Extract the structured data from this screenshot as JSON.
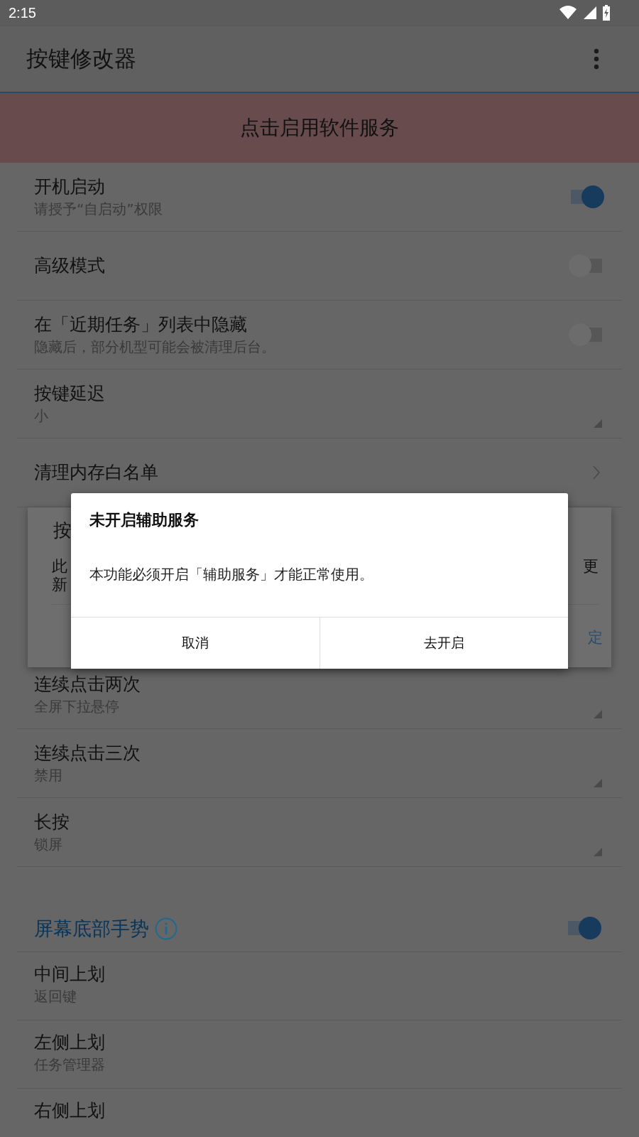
{
  "status_bar": {
    "time": "2:15"
  },
  "app_bar": {
    "title": "按键修改器"
  },
  "banner": {
    "text": "点击启用软件服务"
  },
  "settings": [
    {
      "kind": "switch",
      "title": "开机启动",
      "subtitle": "请授予“自启动”权限",
      "on": true
    },
    {
      "kind": "switch",
      "title": "高级模式",
      "on": false
    },
    {
      "kind": "switch",
      "title": "在「近期任务」列表中隐藏",
      "subtitle": "隐藏后，部分机型可能会被清理后台。",
      "on": false
    },
    {
      "kind": "dropdown",
      "title": "按键延迟",
      "subtitle": "小"
    },
    {
      "kind": "link",
      "title": "清理内存白名单"
    }
  ],
  "click_settings": [
    {
      "kind": "dropdown",
      "title": "连续点击两次",
      "subtitle": "全屏下拉悬停"
    },
    {
      "kind": "dropdown",
      "title": "连续点击三次",
      "subtitle": "禁用"
    },
    {
      "kind": "dropdown",
      "title": "长按",
      "subtitle": "锁屏"
    }
  ],
  "gesture_section": {
    "title": "屏幕底部手势",
    "on": true,
    "items": [
      {
        "kind": "text",
        "title": "中间上划",
        "subtitle": "返回键"
      },
      {
        "kind": "text",
        "title": "左侧上划",
        "subtitle": "任务管理器"
      },
      {
        "kind": "text",
        "title": "右侧上划"
      }
    ]
  },
  "background_dialog": {
    "title": "按",
    "message_lines": [
      "此",
      "新"
    ],
    "message_end": "更",
    "button": "定"
  },
  "dialog": {
    "title": "未开启辅助服务",
    "message": "本功能必须开启「辅助服务」才能正常使用。",
    "buttons": [
      "取消",
      "去开启"
    ]
  }
}
